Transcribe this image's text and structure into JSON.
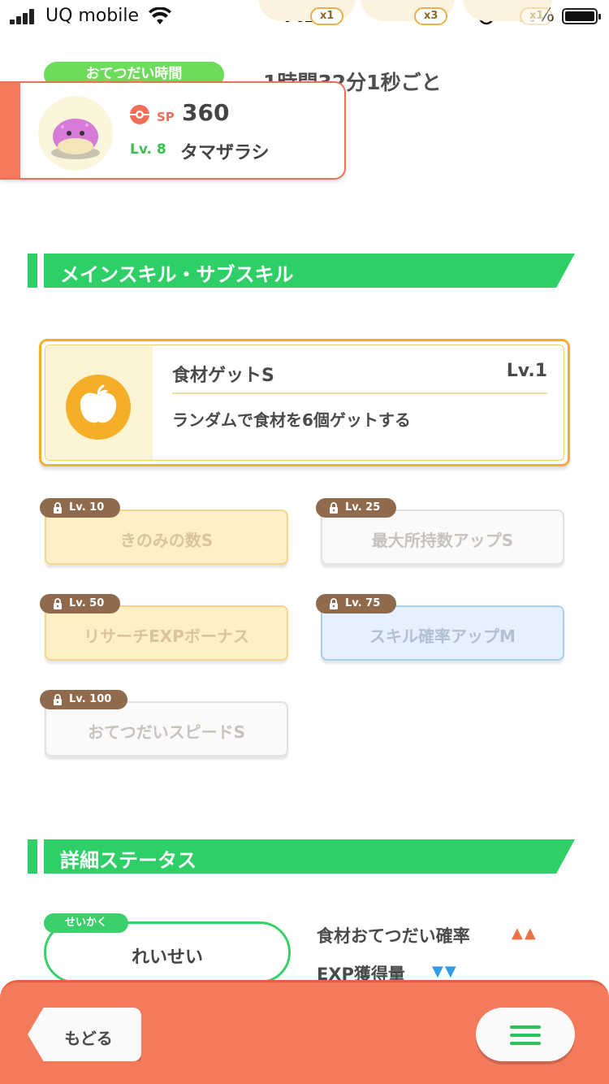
{
  "status_bar": {
    "carrier": "UQ mobile",
    "time": "7:29",
    "battery": "100%"
  },
  "header": {
    "multipliers": [
      "x1",
      "x3",
      "x1"
    ],
    "help_time_label": "おてつだい時間",
    "help_time_value": "1時間32分1秒ごと"
  },
  "pokemon": {
    "sp_label": "SP",
    "sp_value": "360",
    "level_label": "Lv. 8",
    "name": "タマザラシ"
  },
  "skills_section": {
    "title": "メインスキル・サブスキル",
    "main_skill": {
      "name": "食材ゲットS",
      "level": "Lv.1",
      "description": "ランダムで食材を6個ゲットする",
      "icon": "apple-icon"
    },
    "sub_skills": [
      {
        "unlock_level": "Lv. 10",
        "label": "きのみの数S",
        "tier": "gold"
      },
      {
        "unlock_level": "Lv. 25",
        "label": "最大所持数アップS",
        "tier": "white"
      },
      {
        "unlock_level": "Lv. 50",
        "label": "リサーチEXPボーナス",
        "tier": "gold"
      },
      {
        "unlock_level": "Lv. 75",
        "label": "スキル確率アップM",
        "tier": "blue"
      },
      {
        "unlock_level": "Lv. 100",
        "label": "おてつだいスピードS",
        "tier": "white"
      }
    ]
  },
  "details_section": {
    "title": "詳細ステータス",
    "nature_label": "せいかく",
    "nature_value": "れいせい",
    "stats": [
      {
        "label": "食材おてつだい確率",
        "arrows": "▲▲",
        "direction": "up"
      },
      {
        "label": "EXP獲得量",
        "arrows": "▼▼",
        "direction": "down"
      }
    ]
  },
  "bottom_bar": {
    "back_label": "もどる",
    "menu_icon": "hamburger-menu-icon"
  },
  "colors": {
    "accent_green": "#2fcf68",
    "accent_orange": "#f47a5c",
    "gold": "#f2b02a",
    "up_arrow": "#f06f46",
    "down_arrow": "#2f9de8"
  }
}
